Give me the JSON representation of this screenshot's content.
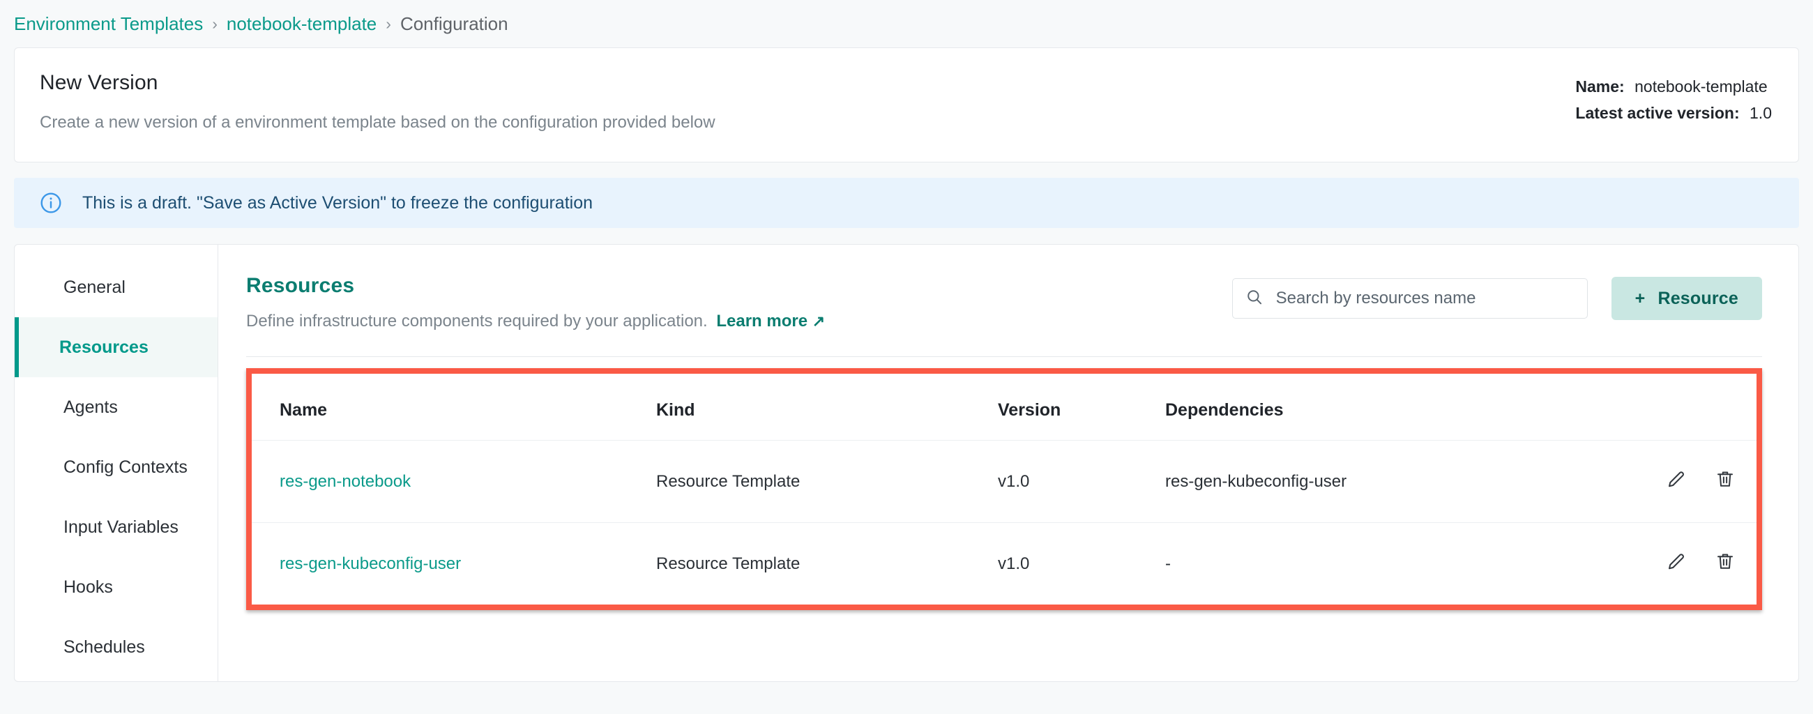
{
  "breadcrumb": {
    "items": [
      {
        "label": "Environment Templates",
        "type": "link"
      },
      {
        "label": "notebook-template",
        "type": "link"
      },
      {
        "label": "Configuration",
        "type": "current"
      }
    ],
    "separator": "›"
  },
  "header": {
    "title": "New Version",
    "subtitle": "Create a new version of a environment template based on the configuration provided below",
    "meta": {
      "name_label": "Name:",
      "name_value": "notebook-template",
      "version_label": "Latest active version:",
      "version_value": "1.0"
    }
  },
  "info_banner": {
    "icon": "info-circle-icon",
    "text": "This is a draft. \"Save as Active Version\" to freeze the configuration",
    "background": "#e8f3fd",
    "accent": "#3b97e8"
  },
  "sidebar": {
    "items": [
      {
        "label": "General",
        "active": false
      },
      {
        "label": "Resources",
        "active": true
      },
      {
        "label": "Agents",
        "active": false
      },
      {
        "label": "Config Contexts",
        "active": false
      },
      {
        "label": "Input Variables",
        "active": false
      },
      {
        "label": "Hooks",
        "active": false
      },
      {
        "label": "Schedules",
        "active": false
      }
    ],
    "active_color": "#00998a"
  },
  "resources": {
    "title": "Resources",
    "description": "Define infrastructure components required by your application.",
    "learn_more": "Learn more",
    "learn_more_icon": "↗",
    "search": {
      "placeholder": "Search by resources name",
      "value": "",
      "icon": "search-icon"
    },
    "add_button": {
      "plus": "+",
      "label": "Resource"
    },
    "table": {
      "columns": [
        "Name",
        "Kind",
        "Version",
        "Dependencies"
      ],
      "rows": [
        {
          "name": "res-gen-notebook",
          "kind": "Resource Template",
          "version": "v1.0",
          "dependencies": "res-gen-kubeconfig-user"
        },
        {
          "name": "res-gen-kubeconfig-user",
          "kind": "Resource Template",
          "version": "v1.0",
          "dependencies": "-"
        }
      ],
      "row_actions": [
        "edit-icon",
        "delete-icon"
      ],
      "highlight_color": "#fa5a46"
    }
  },
  "theme": {
    "accent_teal": "#0b9a8a",
    "page_bg": "#f7f9fa",
    "card_bg": "#ffffff",
    "highlight_red": "#fa5a46"
  }
}
